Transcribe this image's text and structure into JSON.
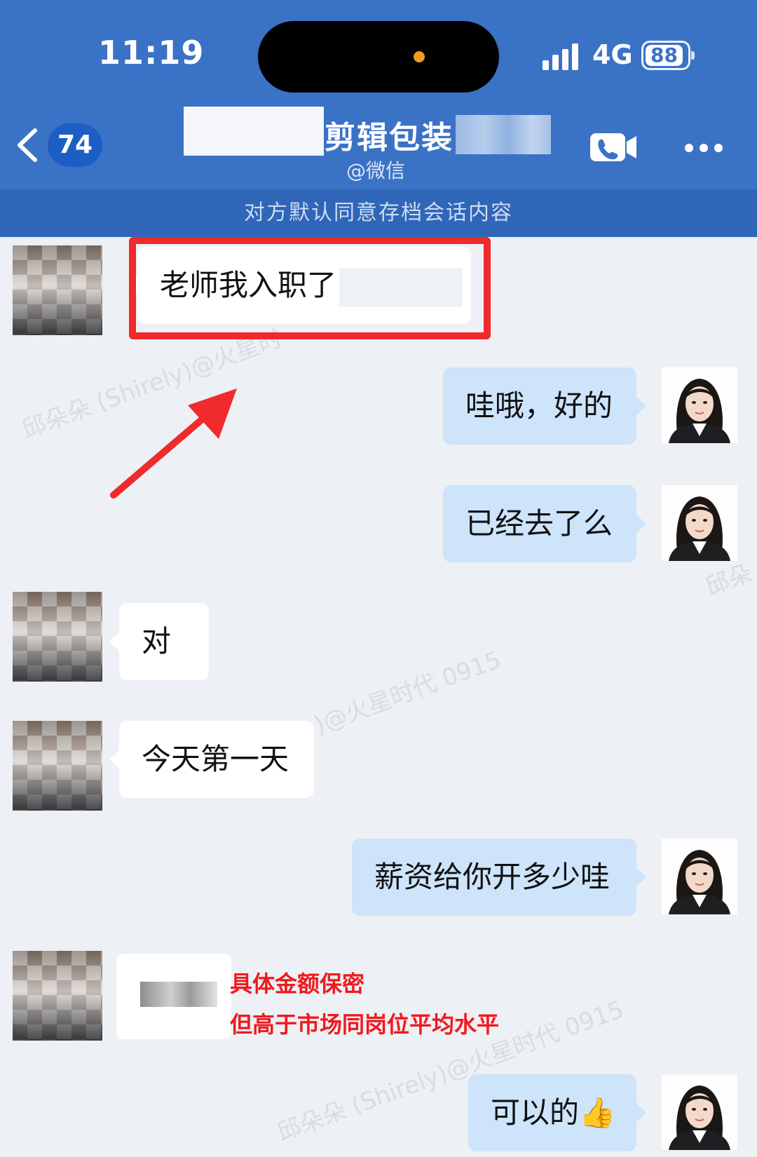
{
  "status_bar": {
    "time": "11:19",
    "network": "4G",
    "battery": "88"
  },
  "header": {
    "unread_count": "74",
    "title": "剪辑包装",
    "subtitle": "@微信",
    "notice": "对方默认同意存档会话内容"
  },
  "messages": [
    {
      "side": "left",
      "text": "老师我入职了"
    },
    {
      "side": "right",
      "text": "哇哦，好的"
    },
    {
      "side": "right",
      "text": "已经去了么"
    },
    {
      "side": "left",
      "text": "对"
    },
    {
      "side": "left",
      "text": "今天第一天"
    },
    {
      "side": "right",
      "text": "薪资给你开多少哇"
    },
    {
      "side": "left",
      "text": ""
    },
    {
      "side": "right",
      "text": "可以的👍"
    }
  ],
  "annotations": {
    "line1": "具体金额保密",
    "line2": "但高于市场同岗位平均水平"
  },
  "watermarks": {
    "w1": "邱朵朵 (Shirely)@火星时",
    "w2": ")@火星时代 0915",
    "w3": "邱朵朵 (Shirely)@火星时代 0915",
    "w4": "邱朵"
  },
  "colors": {
    "header_blue": "#3a72c6",
    "notice_blue": "#2f66b8",
    "right_bubble": "#cde4fb",
    "annotation_red": "#f0191e",
    "chat_background": "#edf0f4"
  },
  "icons": [
    "chevron-left-icon",
    "phone-video-icon",
    "more-icon",
    "signal-icon",
    "battery-icon",
    "thumbs-up-emoji"
  ]
}
